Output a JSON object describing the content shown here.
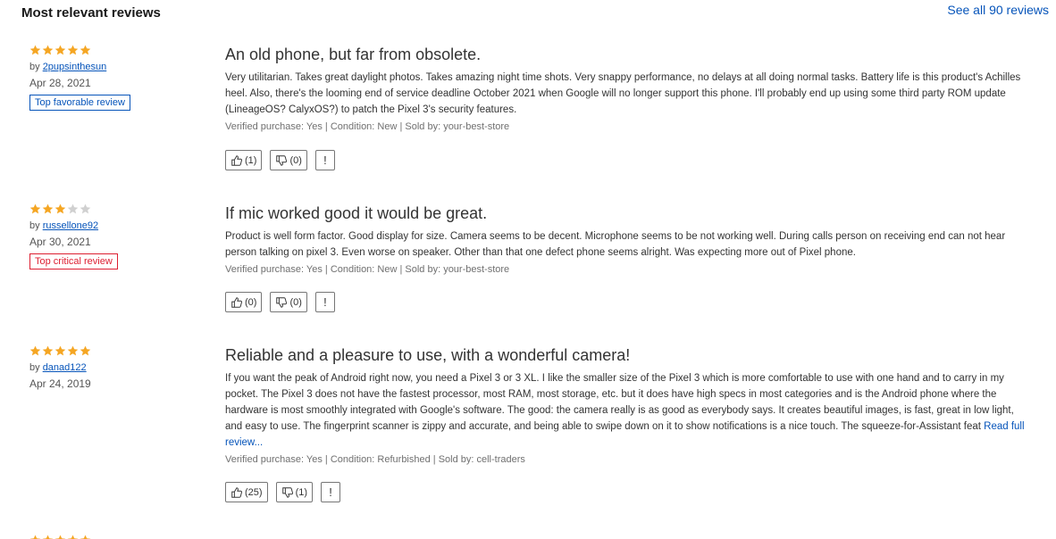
{
  "header": {
    "title": "Most relevant reviews",
    "see_all": "See all 90 reviews"
  },
  "colors": {
    "star_filled": "#f5a623",
    "star_empty": "#d0d0d0",
    "link": "#0654ba",
    "critical": "#dd1e31"
  },
  "reviews": [
    {
      "rating": 5,
      "by_prefix": "by",
      "author": "2pupsinthesun",
      "date": "Apr 28, 2021",
      "badge": "Top favorable review",
      "title": "An old phone, but far from obsolete.",
      "body": "Very utilitarian.  Takes great daylight photos.  Takes amazing night time shots.  Very snappy performance, no delays at all doing normal tasks. Battery life is this product's Achilles heel.  Also, there's the looming end of service deadline October 2021 when Google will no longer support this phone.  I'll probably end up using some third party ROM update (LineageOS? CalyxOS?) to patch the Pixel 3's security features.",
      "read_more": "",
      "meta": "Verified purchase: Yes | Condition: New | Sold by: your-best-store",
      "helpful": "(1)",
      "unhelpful": "(0)",
      "report": "!"
    },
    {
      "rating": 3,
      "by_prefix": "by",
      "author": "russellone92",
      "date": "Apr 30, 2021",
      "badge": "Top critical review",
      "title": "If mic worked good it would be great.",
      "body": "Product is well form factor. Good display for size. Camera seems to be decent. Microphone seems to be not working well. During calls person on receiving end can not hear person talking on pixel 3. Even worse on speaker. Other than that one defect phone seems alright. Was expecting more out of Pixel phone.",
      "read_more": "",
      "meta": "Verified purchase: Yes | Condition: New | Sold by: your-best-store",
      "helpful": "(0)",
      "unhelpful": "(0)",
      "report": "!"
    },
    {
      "rating": 5,
      "by_prefix": "by",
      "author": "danad122",
      "date": "Apr 24, 2019",
      "badge": "",
      "title": "Reliable and a pleasure to use, with a wonderful camera!",
      "body": "If you want the peak of Android right now, you need a Pixel 3 or 3 XL. I like the smaller size of the Pixel 3 which is more comfortable to use with one hand and to carry in my pocket. The Pixel 3 does not have the fastest processor, most RAM, most storage, etc. but it does have high specs in most categories and is the Android phone where the hardware is most smoothly integrated with Google's software. The good: the camera really is as good as everybody says. It creates beautiful images, is fast, great in low light, and easy to use. The fingerprint scanner is zippy and accurate, and being able to swipe down on it to show notifications is a nice touch. The squeeze-for-Assistant feat ",
      "read_more": "Read full review...",
      "meta": "Verified purchase: Yes | Condition: Refurbished | Sold by: cell-traders",
      "helpful": "(25)",
      "unhelpful": "(1)",
      "report": "!"
    },
    {
      "rating": 5
    }
  ]
}
